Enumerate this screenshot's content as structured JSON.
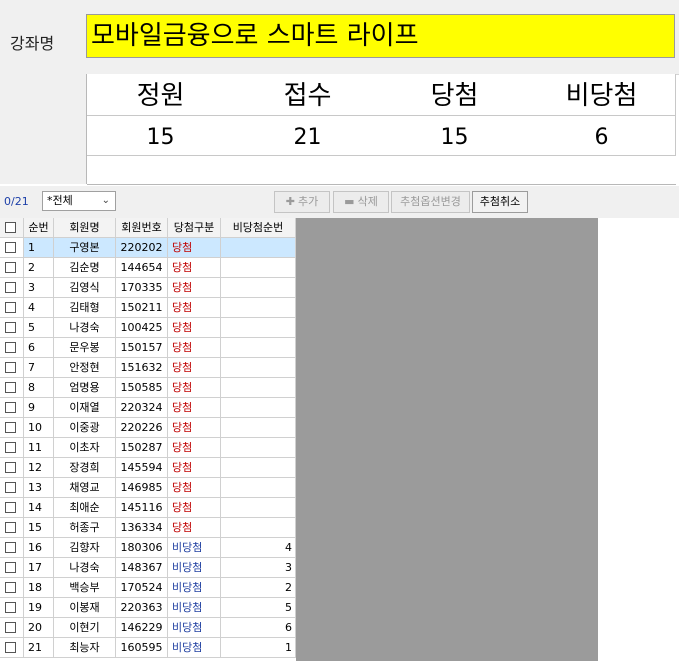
{
  "course": {
    "label": "강좌명",
    "name": "모바일금융으로 스마트 라이프"
  },
  "stats": {
    "headers": [
      "정원",
      "접수",
      "당첨",
      "비당첨"
    ],
    "values": [
      "15",
      "21",
      "15",
      "6"
    ]
  },
  "toolbar": {
    "count": "0/21",
    "filter": "*전체",
    "add_label": "추가",
    "delete_label": "삭제",
    "change_option_label": "추첨옵션변경",
    "cancel_label": "추첨취소"
  },
  "colors": {
    "win": "#c00000",
    "lose": "#1f3fa0",
    "highlight": "#ffff00"
  },
  "table": {
    "headers": [
      "순번",
      "회원명",
      "회원번호",
      "당첨구분",
      "비당첨순번"
    ],
    "rows": [
      {
        "no": "1",
        "name": "구영본",
        "id": "220202",
        "status": "당첨",
        "rank": ""
      },
      {
        "no": "2",
        "name": "김순명",
        "id": "144654",
        "status": "당첨",
        "rank": ""
      },
      {
        "no": "3",
        "name": "김영식",
        "id": "170335",
        "status": "당첨",
        "rank": ""
      },
      {
        "no": "4",
        "name": "김태형",
        "id": "150211",
        "status": "당첨",
        "rank": ""
      },
      {
        "no": "5",
        "name": "나경숙",
        "id": "100425",
        "status": "당첨",
        "rank": ""
      },
      {
        "no": "6",
        "name": "문우봉",
        "id": "150157",
        "status": "당첨",
        "rank": ""
      },
      {
        "no": "7",
        "name": "안정현",
        "id": "151632",
        "status": "당첨",
        "rank": ""
      },
      {
        "no": "8",
        "name": "엄명용",
        "id": "150585",
        "status": "당첨",
        "rank": ""
      },
      {
        "no": "9",
        "name": "이재열",
        "id": "220324",
        "status": "당첨",
        "rank": ""
      },
      {
        "no": "10",
        "name": "이중광",
        "id": "220226",
        "status": "당첨",
        "rank": ""
      },
      {
        "no": "11",
        "name": "이초자",
        "id": "150287",
        "status": "당첨",
        "rank": ""
      },
      {
        "no": "12",
        "name": "장경희",
        "id": "145594",
        "status": "당첨",
        "rank": ""
      },
      {
        "no": "13",
        "name": "채영교",
        "id": "146985",
        "status": "당첨",
        "rank": ""
      },
      {
        "no": "14",
        "name": "최애순",
        "id": "145116",
        "status": "당첨",
        "rank": ""
      },
      {
        "no": "15",
        "name": "허종구",
        "id": "136334",
        "status": "당첨",
        "rank": ""
      },
      {
        "no": "16",
        "name": "김향자",
        "id": "180306",
        "status": "비당첨",
        "rank": "4"
      },
      {
        "no": "17",
        "name": "나경숙",
        "id": "148367",
        "status": "비당첨",
        "rank": "3"
      },
      {
        "no": "18",
        "name": "백승부",
        "id": "170524",
        "status": "비당첨",
        "rank": "2"
      },
      {
        "no": "19",
        "name": "이봉재",
        "id": "220363",
        "status": "비당첨",
        "rank": "5"
      },
      {
        "no": "20",
        "name": "이현기",
        "id": "146229",
        "status": "비당첨",
        "rank": "6"
      },
      {
        "no": "21",
        "name": "최능자",
        "id": "160595",
        "status": "비당첨",
        "rank": "1"
      }
    ]
  }
}
